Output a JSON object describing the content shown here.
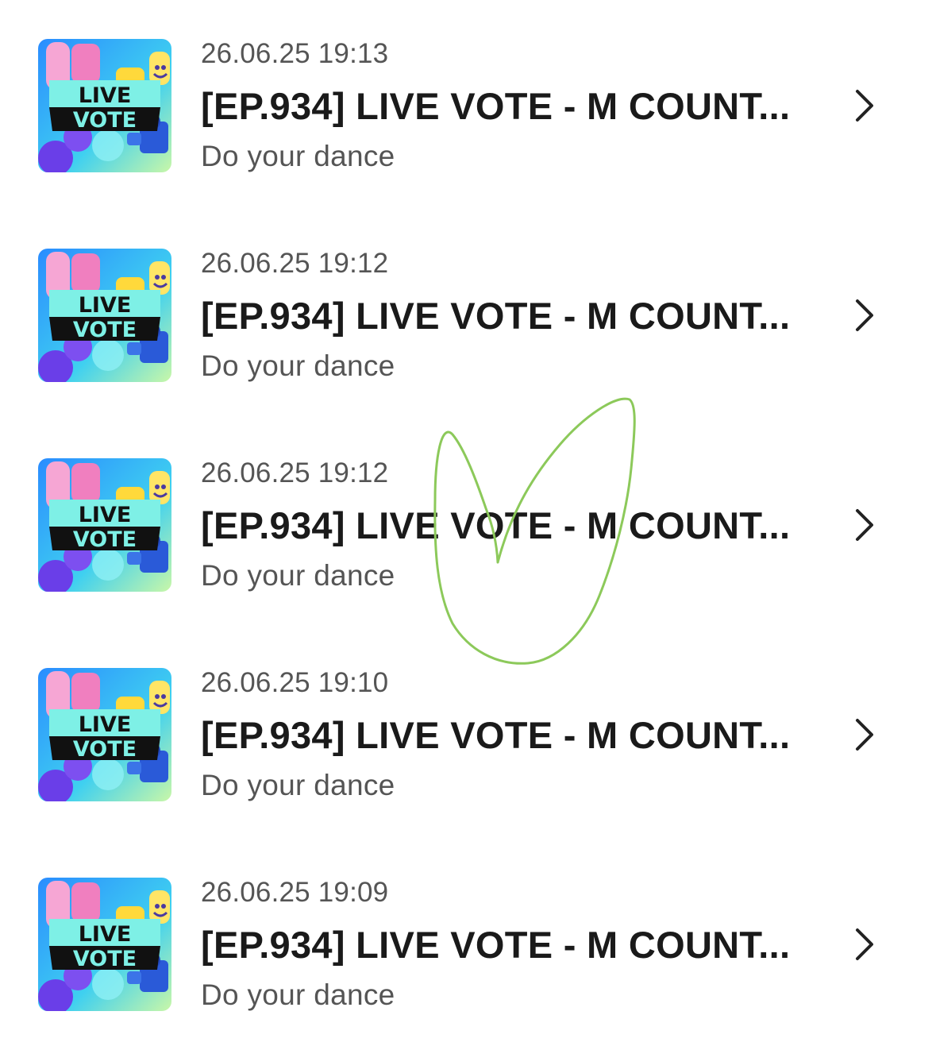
{
  "items": [
    {
      "date": "26.06.25 19:13",
      "title": "[EP.934] LIVE VOTE - M COUNT...",
      "subtitle": "Do your dance",
      "thumb_line1": "LIVE",
      "thumb_line2": "VOTE"
    },
    {
      "date": "26.06.25 19:12",
      "title": "[EP.934] LIVE VOTE - M COUNT...",
      "subtitle": "Do your dance",
      "thumb_line1": "LIVE",
      "thumb_line2": "VOTE"
    },
    {
      "date": "26.06.25 19:12",
      "title": "[EP.934] LIVE VOTE - M COUNT...",
      "subtitle": "Do your dance",
      "thumb_line1": "LIVE",
      "thumb_line2": "VOTE"
    },
    {
      "date": "26.06.25 19:10",
      "title": "[EP.934] LIVE VOTE - M COUNT...",
      "subtitle": "Do your dance",
      "thumb_line1": "LIVE",
      "thumb_line2": "VOTE"
    },
    {
      "date": "26.06.25 19:09",
      "title": "[EP.934] LIVE VOTE - M COUNT...",
      "subtitle": "Do your dance",
      "thumb_line1": "LIVE",
      "thumb_line2": "VOTE"
    }
  ],
  "icons": {
    "row_arrow": "chevron-right-icon",
    "annotation": "hand-drawn-check-mark"
  },
  "colors": {
    "title": "#1a1a1a",
    "meta": "#555555",
    "annotation_stroke": "#8cc95a",
    "thumb_bg": "#1f6df0",
    "thumb_band": "#7ef0e6"
  }
}
